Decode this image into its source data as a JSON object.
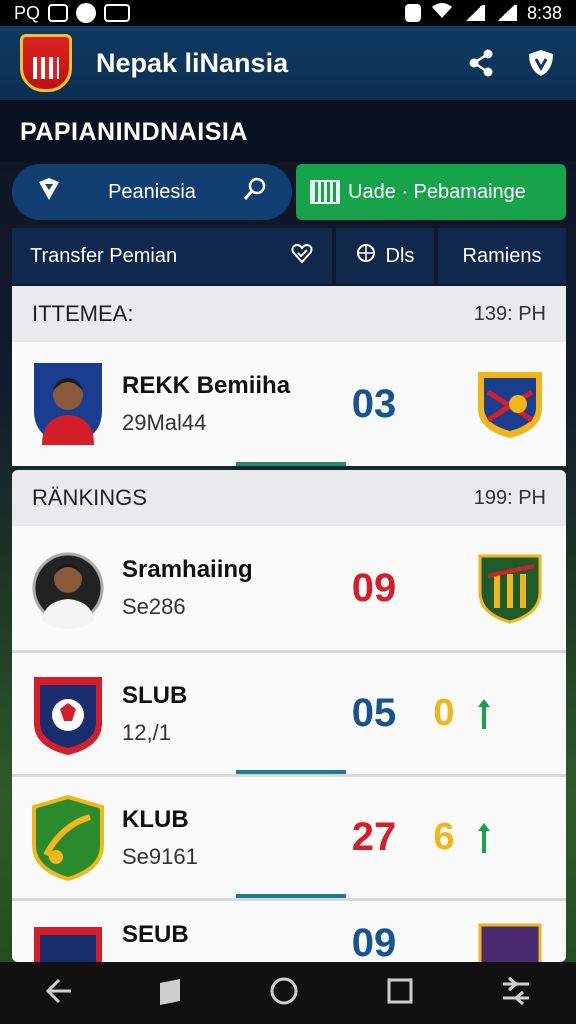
{
  "status_bar": {
    "left_text": "PQ",
    "time": "8:38"
  },
  "app_bar": {
    "title": "Nepak liNansia"
  },
  "section_title": "PAPIANINDNAISIA",
  "search_pill": {
    "label": "Peaniesia"
  },
  "update_pill": {
    "label": "Uade · Pebamainge"
  },
  "tabs": {
    "transfer": "Transfer Pemian",
    "dls": "Dls",
    "rankings": "Ramiens"
  },
  "card1": {
    "header": "ITTEMEA:",
    "time": "139: PH",
    "row": {
      "name": "REKK Bemiiha",
      "sub": "29Mal44",
      "score": "03"
    }
  },
  "card2": {
    "header": "RÄNKINGS",
    "time": "199: PH",
    "rows": [
      {
        "name": "Sramhaiing",
        "sub": "Se286",
        "score": "09",
        "extra": ""
      },
      {
        "name": "SLUB",
        "sub": "12,/1",
        "score": "05",
        "extra": "0"
      },
      {
        "name": "KLUB",
        "sub": "Se9161",
        "score": "27",
        "extra": "6"
      },
      {
        "name": "SEUB",
        "sub": "",
        "score": "09",
        "extra": ""
      }
    ]
  },
  "colors": {
    "blue_score": "#17548f",
    "red_score": "#d41f2a",
    "accent_green": "#17a34a",
    "app_bar": "#0f3a63"
  }
}
